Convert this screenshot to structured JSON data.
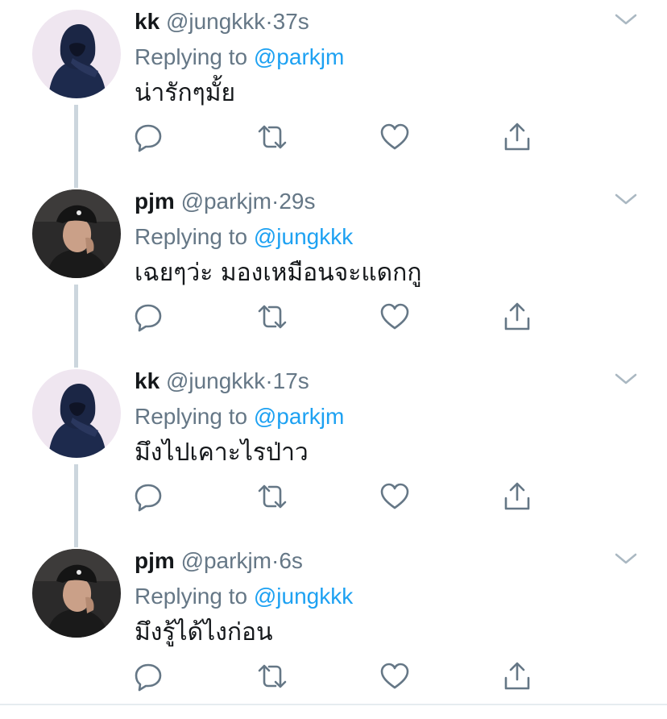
{
  "tweets": [
    {
      "name": "kk",
      "handle": "@jungkkk",
      "dot": "·",
      "time": "37s",
      "replying_label": "Replying to",
      "replying_to": "@parkjm",
      "text": "น่ารักๆมั้ย",
      "avatar": "hooded-avatar"
    },
    {
      "name": "pjm",
      "handle": "@parkjm",
      "dot": "·",
      "time": "29s",
      "replying_label": "Replying to",
      "replying_to": "@jungkkk",
      "text": "เฉยๆว่ะ มองเหมือนจะแดกกู",
      "avatar": "cap-avatar"
    },
    {
      "name": "kk",
      "handle": "@jungkkk",
      "dot": "·",
      "time": "17s",
      "replying_label": "Replying to",
      "replying_to": "@parkjm",
      "text": "มึงไปเคาะไรป่าว",
      "avatar": "hooded-avatar"
    },
    {
      "name": "pjm",
      "handle": "@parkjm",
      "dot": "·",
      "time": "6s",
      "replying_label": "Replying to",
      "replying_to": "@jungkkk",
      "text": "มึงรู้ได้ไงก่อน",
      "avatar": "cap-avatar"
    }
  ],
  "icons": [
    "chevron-down-icon",
    "reply-icon",
    "retweet-icon",
    "like-icon",
    "share-icon"
  ],
  "colors": {
    "text": "#14171a",
    "secondary": "#657786",
    "link": "#1da1f2",
    "thread_line": "#ccd6dd",
    "icon": "#657786"
  }
}
